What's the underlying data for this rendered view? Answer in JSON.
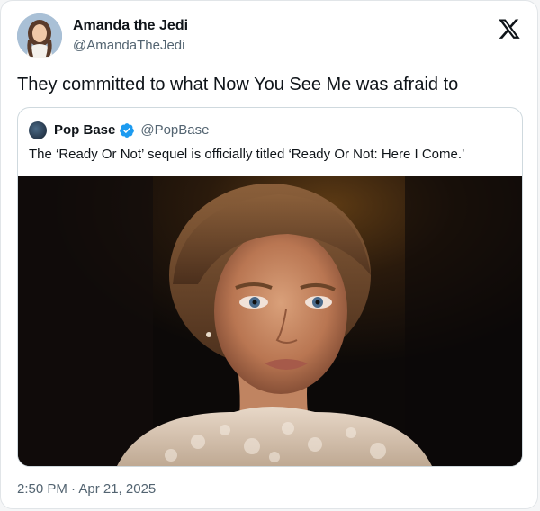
{
  "author": {
    "display_name": "Amanda the Jedi",
    "handle": "@AmandaTheJedi",
    "avatar_icon": "profile-photo"
  },
  "platform_icon": "x-logo-icon",
  "tweet": {
    "text": "They committed to what Now You See Me was afraid to",
    "timestamp": "2:50 PM · Apr 21, 2025"
  },
  "quoted_tweet": {
    "author": {
      "display_name": "Pop Base",
      "handle": "@PopBase",
      "verified": true,
      "verified_color": "#1d9bf0"
    },
    "text": "The ‘Ready Or Not’ sequel is officially titled ‘Ready Or Not: Here I Come.’",
    "media": {
      "type": "photo"
    }
  },
  "colors": {
    "text_primary": "#0f1419",
    "text_secondary": "#536471",
    "border": "#cfd9de"
  }
}
